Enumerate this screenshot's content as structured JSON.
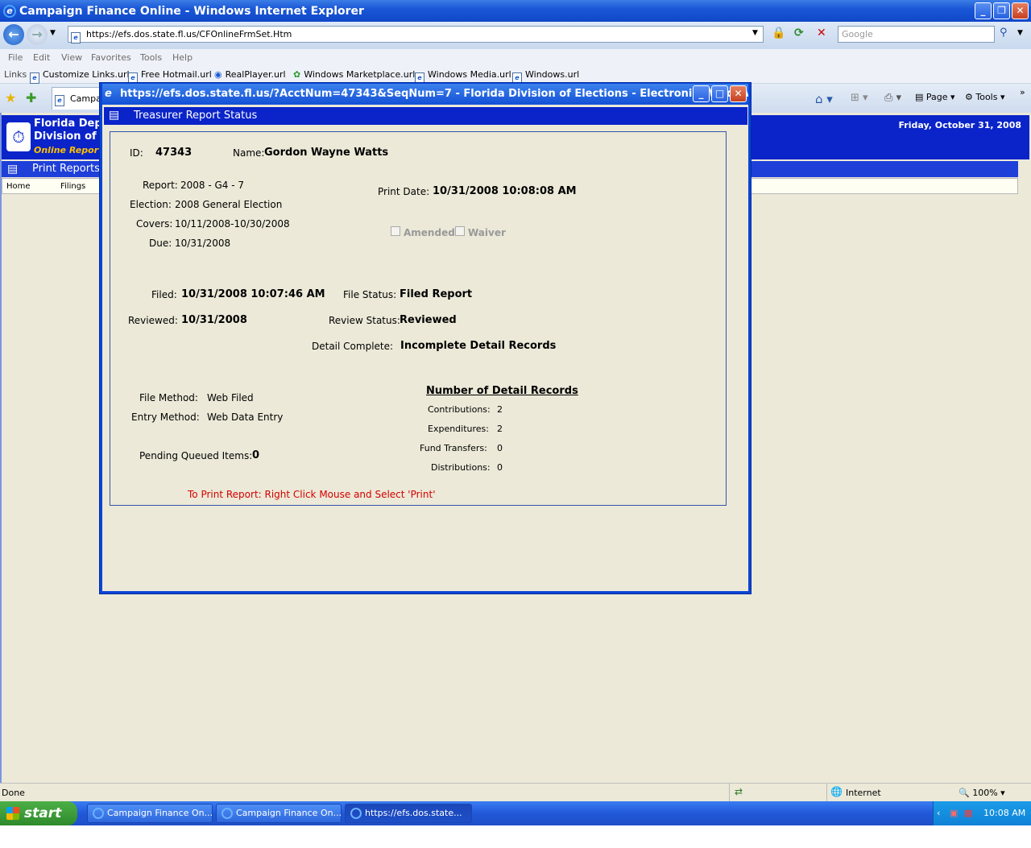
{
  "browser": {
    "window_title": "Campaign Finance Online - Windows Internet Explorer",
    "url": "https://efs.dos.state.fl.us/CFOnlineFrmSet.Htm",
    "search_placeholder": "Google",
    "menu": [
      "File",
      "Edit",
      "View",
      "Favorites",
      "Tools",
      "Help"
    ],
    "links_label": "Links",
    "links": [
      "Customize Links.url",
      "Free Hotmail.url",
      "RealPlayer.url",
      "Windows Marketplace.url",
      "Windows Media.url",
      "Windows.url"
    ],
    "tab_label": "Campai",
    "toolbar": {
      "page": "Page",
      "tools": "Tools"
    },
    "status": {
      "done": "Done",
      "zone": "Internet",
      "zoom": "100%"
    }
  },
  "site": {
    "title_line1": "Florida Depa",
    "title_line2": "Division of E",
    "online": "Online Reporti",
    "date": "Friday, October 31, 2008",
    "section": "Print Reports",
    "nav": [
      "Home",
      "Filings"
    ]
  },
  "popup": {
    "title": "https://efs.dos.state.fl.us/?AcctNum=47343&SeqNum=7 - Florida Division of Elections - Electroni - Windows Int...",
    "header": "Treasurer Report Status",
    "id_label": "ID:",
    "id_value": "47343",
    "name_label": "Name:",
    "name_value": "Gordon Wayne Watts",
    "report_label": "Report:",
    "report_value": "2008 - G4 - 7",
    "election_label": "Election:",
    "election_value": "2008 General Election",
    "covers_label": "Covers:",
    "covers_value": "10/11/2008-10/30/2008",
    "due_label": "Due:",
    "due_value": "10/31/2008",
    "print_date_label": "Print Date:",
    "print_date_value": "10/31/2008 10:08:08 AM",
    "amended_label": "Amended",
    "waiver_label": "Waiver",
    "filed_label": "Filed:",
    "filed_value": "10/31/2008 10:07:46 AM",
    "file_status_label": "File Status:",
    "file_status_value": "Filed Report",
    "reviewed_label": "Reviewed:",
    "reviewed_value": "10/31/2008",
    "review_status_label": "Review Status:",
    "review_status_value": "Reviewed",
    "detail_complete_label": "Detail Complete:",
    "detail_complete_value": "Incomplete Detail Records",
    "file_method_label": "File Method:",
    "file_method_value": "Web Filed",
    "entry_method_label": "Entry Method:",
    "entry_method_value": "Web Data Entry",
    "pending_label": "Pending Queued Items:",
    "pending_value": "0",
    "detail_records_title": "Number of Detail Records",
    "contributions_label": "Contributions:",
    "contributions_value": "2",
    "expenditures_label": "Expenditures:",
    "expenditures_value": "2",
    "fund_transfers_label": "Fund Transfers:",
    "fund_transfers_value": "0",
    "distributions_label": "Distributions:",
    "distributions_value": "0",
    "print_hint": "To Print Report: Right Click Mouse and Select 'Print'"
  },
  "taskbar": {
    "start": "start",
    "tasks": [
      "Campaign Finance On...",
      "Campaign Finance On...",
      "https://efs.dos.state..."
    ],
    "clock": "10:08 AM"
  },
  "colors": {
    "hint_red": "#d40000",
    "fl_blue": "#0a24c9",
    "online_gold": "#ffc000"
  }
}
